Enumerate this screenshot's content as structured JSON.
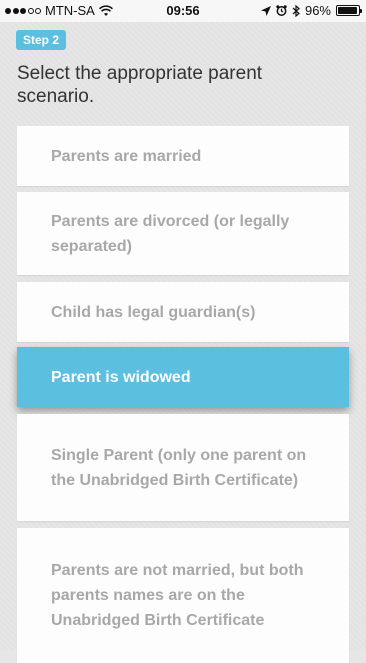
{
  "status_bar": {
    "carrier": "MTN-SA",
    "time": "09:56",
    "battery_percent": "96%",
    "battery_level": 0.96,
    "icons": [
      "signal-icon",
      "wifi-icon",
      "location-icon",
      "alarm-icon",
      "bluetooth-icon",
      "battery-icon"
    ]
  },
  "header": {
    "step_label": "Step 2",
    "prompt": "Select the appropriate parent scenario."
  },
  "options": [
    {
      "label": "Parents are married",
      "selected": false
    },
    {
      "label": "Parents are divorced (or legally separated)",
      "selected": false
    },
    {
      "label": "Child has legal guardian(s)",
      "selected": false
    },
    {
      "label": "Parent is widowed",
      "selected": true
    },
    {
      "label": "Single Parent (only one parent on the Unabridged Birth Certificate)",
      "selected": false
    },
    {
      "label": "Parents are not married, but both parents names are on the Unabridged Birth Certificate",
      "selected": false
    }
  ],
  "colors": {
    "accent": "#5bbfdf",
    "option_text": "#a8a8a8",
    "background": "#e6e6e6"
  }
}
